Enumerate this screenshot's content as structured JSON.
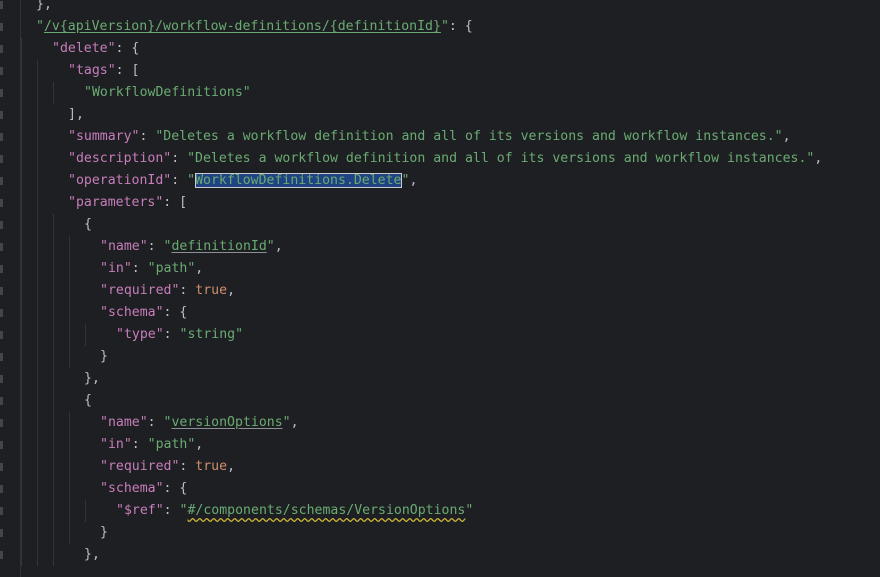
{
  "colors": {
    "background": "#1e1f22",
    "key": "#c77dbb",
    "string": "#6aab73",
    "keyword": "#cf8e6d",
    "punctuation": "#bcbec4",
    "selection_bg": "#214283",
    "warning_underline": "#c9b33a"
  },
  "lines": [
    {
      "i": 0,
      "tokens": [
        {
          "t": "p",
          "v": "},"
        }
      ]
    },
    {
      "i": 0,
      "tokens": [
        {
          "t": "s",
          "v": "\""
        },
        {
          "t": "s",
          "v": "/v{apiVersion}/workflow-definitions/{definitionId}",
          "d": "link"
        },
        {
          "t": "s",
          "v": "\""
        },
        {
          "t": "p",
          "v": ": {"
        }
      ]
    },
    {
      "i": 1,
      "tokens": [
        {
          "t": "k",
          "v": "\"delete\""
        },
        {
          "t": "p",
          "v": ": {"
        }
      ]
    },
    {
      "i": 2,
      "tokens": [
        {
          "t": "k",
          "v": "\"tags\""
        },
        {
          "t": "p",
          "v": ": ["
        }
      ]
    },
    {
      "i": 3,
      "tokens": [
        {
          "t": "s",
          "v": "\"WorkflowDefinitions\""
        }
      ]
    },
    {
      "i": 2,
      "tokens": [
        {
          "t": "p",
          "v": "],"
        }
      ]
    },
    {
      "i": 2,
      "tokens": [
        {
          "t": "k",
          "v": "\"summary\""
        },
        {
          "t": "p",
          "v": ": "
        },
        {
          "t": "s",
          "v": "\"Deletes a workflow definition and all of its versions and workflow instances.\""
        },
        {
          "t": "p",
          "v": ","
        }
      ]
    },
    {
      "i": 2,
      "tokens": [
        {
          "t": "k",
          "v": "\"description\""
        },
        {
          "t": "p",
          "v": ": "
        },
        {
          "t": "s",
          "v": "\"Deletes a workflow definition and all of its versions and workflow instances.\""
        },
        {
          "t": "p",
          "v": ","
        }
      ]
    },
    {
      "i": 2,
      "tokens": [
        {
          "t": "k",
          "v": "\"operationId\""
        },
        {
          "t": "p",
          "v": ": "
        },
        {
          "t": "s",
          "v": "\""
        },
        {
          "t": "s",
          "v": "WorkflowDefinitions.Delete",
          "d": "sel"
        },
        {
          "t": "s",
          "v": "\""
        },
        {
          "t": "p",
          "v": ","
        }
      ]
    },
    {
      "i": 2,
      "tokens": [
        {
          "t": "k",
          "v": "\"parameters\""
        },
        {
          "t": "p",
          "v": ": ["
        }
      ]
    },
    {
      "i": 3,
      "tokens": [
        {
          "t": "p",
          "v": "{"
        }
      ]
    },
    {
      "i": 4,
      "tokens": [
        {
          "t": "k",
          "v": "\"name\""
        },
        {
          "t": "p",
          "v": ": "
        },
        {
          "t": "s",
          "v": "\""
        },
        {
          "t": "s",
          "v": "definitionId",
          "d": "u"
        },
        {
          "t": "s",
          "v": "\""
        },
        {
          "t": "p",
          "v": ","
        }
      ]
    },
    {
      "i": 4,
      "tokens": [
        {
          "t": "k",
          "v": "\"in\""
        },
        {
          "t": "p",
          "v": ": "
        },
        {
          "t": "s",
          "v": "\"path\""
        },
        {
          "t": "p",
          "v": ","
        }
      ]
    },
    {
      "i": 4,
      "tokens": [
        {
          "t": "k",
          "v": "\"required\""
        },
        {
          "t": "p",
          "v": ": "
        },
        {
          "t": "kw",
          "v": "true"
        },
        {
          "t": "p",
          "v": ","
        }
      ]
    },
    {
      "i": 4,
      "tokens": [
        {
          "t": "k",
          "v": "\"schema\""
        },
        {
          "t": "p",
          "v": ": {"
        }
      ]
    },
    {
      "i": 5,
      "tokens": [
        {
          "t": "k",
          "v": "\"type\""
        },
        {
          "t": "p",
          "v": ": "
        },
        {
          "t": "s",
          "v": "\"string\""
        }
      ]
    },
    {
      "i": 4,
      "tokens": [
        {
          "t": "p",
          "v": "}"
        }
      ]
    },
    {
      "i": 3,
      "tokens": [
        {
          "t": "p",
          "v": "},"
        }
      ]
    },
    {
      "i": 3,
      "tokens": [
        {
          "t": "p",
          "v": "{"
        }
      ]
    },
    {
      "i": 4,
      "tokens": [
        {
          "t": "k",
          "v": "\"name\""
        },
        {
          "t": "p",
          "v": ": "
        },
        {
          "t": "s",
          "v": "\""
        },
        {
          "t": "s",
          "v": "versionOptions",
          "d": "u"
        },
        {
          "t": "s",
          "v": "\""
        },
        {
          "t": "p",
          "v": ","
        }
      ]
    },
    {
      "i": 4,
      "tokens": [
        {
          "t": "k",
          "v": "\"in\""
        },
        {
          "t": "p",
          "v": ": "
        },
        {
          "t": "s",
          "v": "\"path\""
        },
        {
          "t": "p",
          "v": ","
        }
      ]
    },
    {
      "i": 4,
      "tokens": [
        {
          "t": "k",
          "v": "\"required\""
        },
        {
          "t": "p",
          "v": ": "
        },
        {
          "t": "kw",
          "v": "true"
        },
        {
          "t": "p",
          "v": ","
        }
      ]
    },
    {
      "i": 4,
      "tokens": [
        {
          "t": "k",
          "v": "\"schema\""
        },
        {
          "t": "p",
          "v": ": {"
        }
      ]
    },
    {
      "i": 5,
      "tokens": [
        {
          "t": "k",
          "v": "\"$ref\""
        },
        {
          "t": "p",
          "v": ": "
        },
        {
          "t": "s",
          "v": "\""
        },
        {
          "t": "s",
          "v": "#/components/schemas/VersionOptions",
          "d": "wavy"
        },
        {
          "t": "s",
          "v": "\""
        }
      ]
    },
    {
      "i": 4,
      "tokens": [
        {
          "t": "p",
          "v": "}"
        }
      ]
    },
    {
      "i": 3,
      "tokens": [
        {
          "t": "p",
          "v": "},"
        }
      ]
    }
  ]
}
